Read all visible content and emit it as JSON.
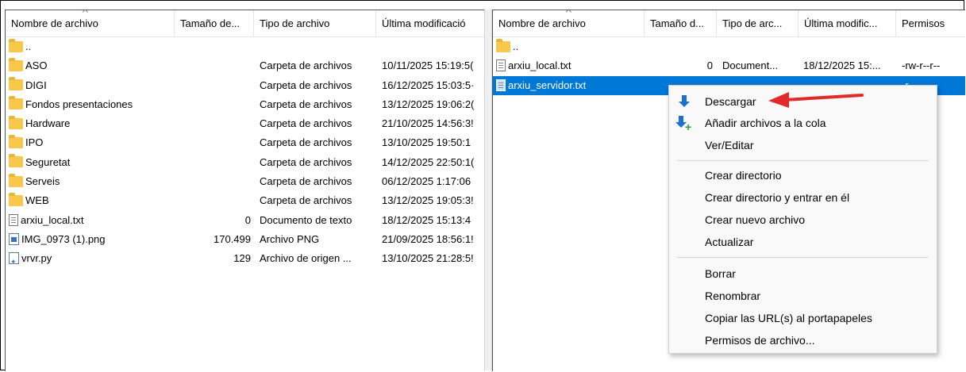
{
  "local": {
    "columns": [
      "Nombre de archivo",
      "Tamaño de...",
      "Tipo de archivo",
      "Última modificació"
    ],
    "rows": [
      {
        "icon": "folder-icon",
        "name": "..",
        "size": "",
        "type": "",
        "modified": ""
      },
      {
        "icon": "folder-icon",
        "name": "ASO",
        "size": "",
        "type": "Carpeta de archivos",
        "modified": "10/11/2025 15:19:5("
      },
      {
        "icon": "folder-icon",
        "name": "DIGI",
        "size": "",
        "type": "Carpeta de archivos",
        "modified": "16/12/2025 15:03:5·"
      },
      {
        "icon": "folder-icon",
        "name": "Fondos presentaciones",
        "size": "",
        "type": "Carpeta de archivos",
        "modified": "13/12/2025 19:06:2("
      },
      {
        "icon": "folder-icon",
        "name": "Hardware",
        "size": "",
        "type": "Carpeta de archivos",
        "modified": "21/10/2025 14:56:3!"
      },
      {
        "icon": "folder-icon",
        "name": "IPO",
        "size": "",
        "type": "Carpeta de archivos",
        "modified": "13/10/2025 19:50:1"
      },
      {
        "icon": "folder-icon",
        "name": "Seguretat",
        "size": "",
        "type": "Carpeta de archivos",
        "modified": "14/12/2025 22:50:1("
      },
      {
        "icon": "folder-icon",
        "name": "Serveis",
        "size": "",
        "type": "Carpeta de archivos",
        "modified": "06/12/2025 1:17:06"
      },
      {
        "icon": "folder-icon",
        "name": "WEB",
        "size": "",
        "type": "Carpeta de archivos",
        "modified": "13/12/2025 19:05:3!"
      },
      {
        "icon": "text-file-icon",
        "name": "arxiu_local.txt",
        "size": "0",
        "type": "Documento de texto",
        "modified": "18/12/2025 15:13:4"
      },
      {
        "icon": "png-file-icon",
        "name": "IMG_0973 (1).png",
        "size": "170.499",
        "type": "Archivo PNG",
        "modified": "21/09/2025 18:56:1!"
      },
      {
        "icon": "python-file-icon",
        "name": "vrvr.py",
        "size": "129",
        "type": "Archivo de origen ...",
        "modified": "13/10/2025 21:28:5!"
      }
    ]
  },
  "remote": {
    "columns": [
      "Nombre de archivo",
      "Tamaño d...",
      "Tipo de arc...",
      "Última modific...",
      "Permisos"
    ],
    "rows": [
      {
        "icon": "folder-icon",
        "name": "..",
        "size": "",
        "type": "",
        "modified": "",
        "perms": ""
      },
      {
        "icon": "text-file-icon",
        "name": "arxiu_local.txt",
        "size": "0",
        "type": "Document...",
        "modified": "18/12/2025 15:...",
        "perms": "-rw-r--r--"
      },
      {
        "icon": "text-file-icon",
        "name": "arxiu_servidor.txt",
        "size": "",
        "type": "",
        "modified": "",
        "perms": "-r--"
      }
    ]
  },
  "context_menu": {
    "download": "Descargar",
    "add_queue": "Añadir archivos a la cola",
    "view_edit": "Ver/Editar",
    "create_dir": "Crear directorio",
    "create_dir_enter": "Crear directorio y entrar en él",
    "create_file": "Crear nuevo archivo",
    "refresh": "Actualizar",
    "delete": "Borrar",
    "rename": "Renombrar",
    "copy_urls": "Copiar las URL(s) al portapapeles",
    "file_perms": "Permisos de archivo..."
  },
  "colors": {
    "selection": "#0078d7",
    "annotation_arrow": "#e32a2a",
    "folder": "#f7c84a"
  }
}
